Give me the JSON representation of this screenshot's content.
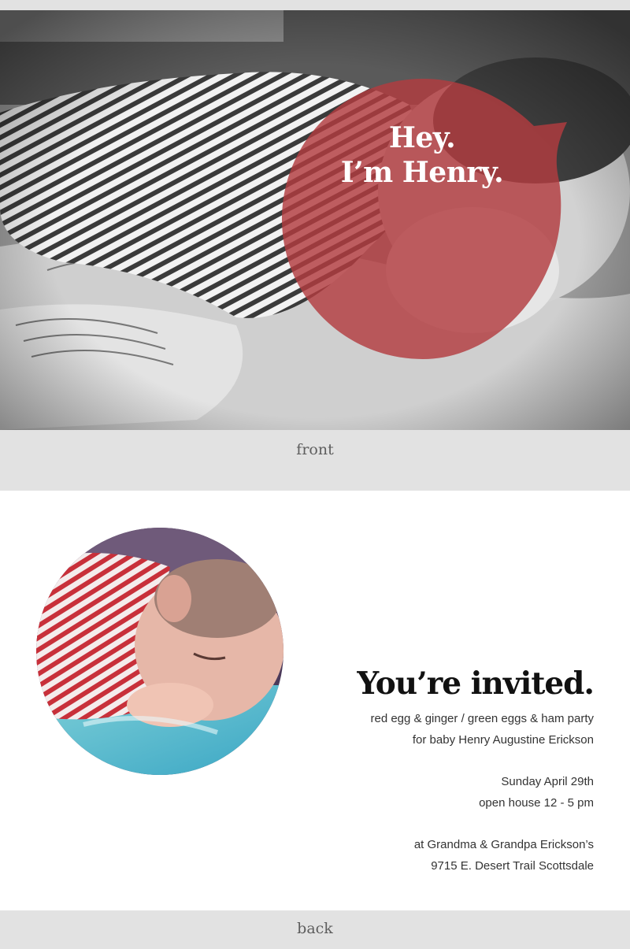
{
  "front": {
    "headline_line1": "Hey.",
    "headline_line2": "I’m Henry.",
    "bubble_color": "#b23c40",
    "caption": "front"
  },
  "back": {
    "heading": "You’re invited.",
    "details": [
      "red egg & ginger / green eggs & ham party",
      "for baby Henry Augustine Erickson"
    ],
    "date": [
      "Sunday April 29th",
      "open house 12 - 5 pm"
    ],
    "location": [
      "at Grandma & Grandpa Erickson’s",
      "9715 E. Desert Trail Scottsdale"
    ],
    "caption": "back"
  },
  "colors": {
    "page_background": "#e2e2e2",
    "card_background": "#ffffff",
    "caption_text": "#5e5e5e",
    "stripe_red": "#c8303a"
  }
}
